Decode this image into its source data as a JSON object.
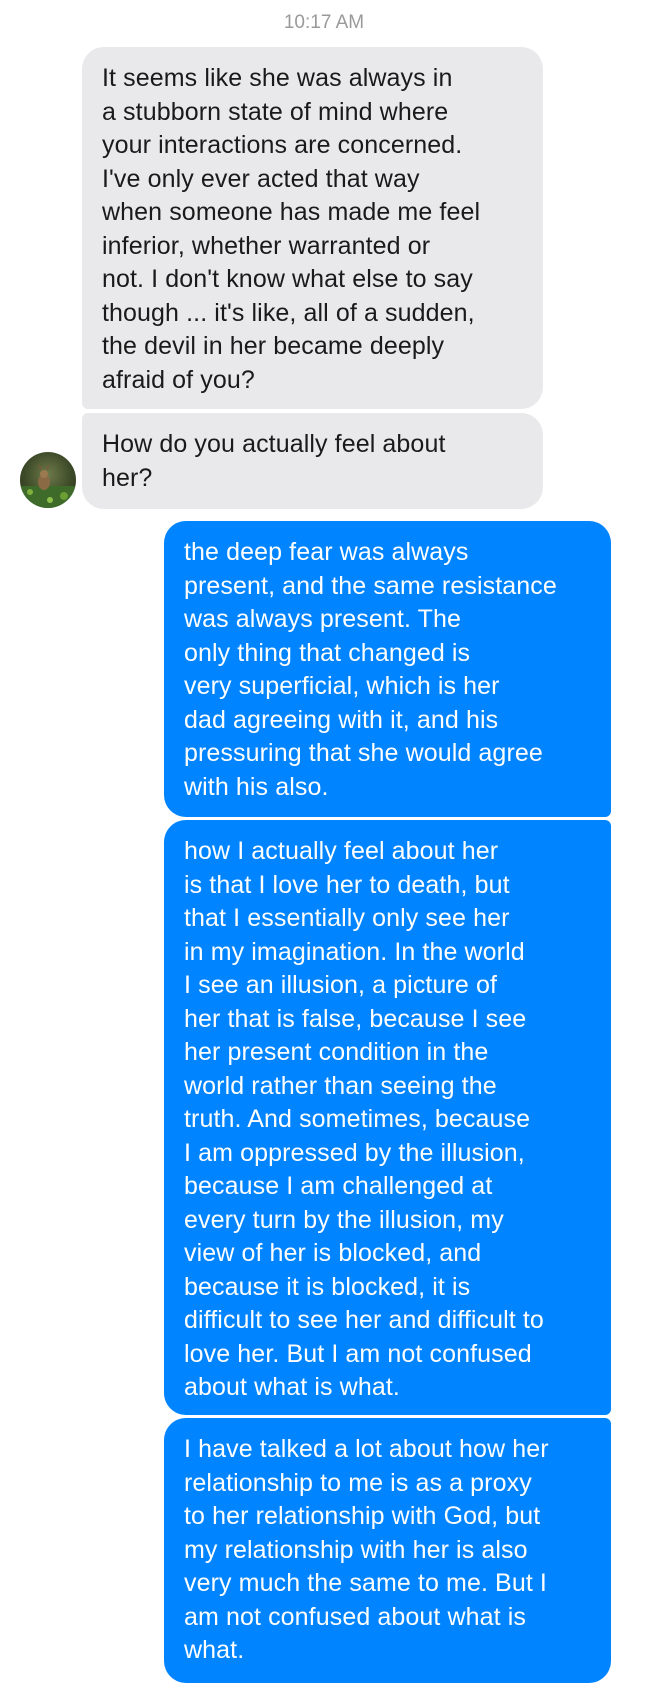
{
  "header": {
    "timestamp": "10:17 AM"
  },
  "contact": {
    "avatar_icon": "nature-photo-avatar"
  },
  "messages": [
    {
      "sender": "incoming",
      "text": "It seems like she was always in\na stubborn state of mind where\nyour interactions are concerned.\nI've only ever acted that way\nwhen someone has made me feel\ninferior, whether warranted or\nnot. I don't know what else to say\nthough ... it's like, all of a sudden,\nthe devil in her became deeply\nafraid of you?"
    },
    {
      "sender": "incoming",
      "text": "How do you actually feel about\nher?"
    },
    {
      "sender": "outgoing",
      "text": "the deep fear was always\npresent, and the same resistance\nwas always present. The\nonly thing that changed is\nvery superficial, which is her\ndad agreeing with it, and his\npressuring that she would agree\nwith his also."
    },
    {
      "sender": "outgoing",
      "text": "how I actually feel about her\nis that I love her to death, but\nthat I essentially only see her\nin my imagination. In the world\nI see an illusion, a picture of\nher that is false, because I see\nher present condition in the\nworld rather than seeing the\ntruth. And sometimes, because\nI am oppressed by the illusion,\nbecause I am challenged at\nevery turn by the illusion, my\nview of her is blocked, and\nbecause it is blocked, it is\ndifficult to see her and difficult to\nlove her. But I am not confused\nabout what is what."
    },
    {
      "sender": "outgoing",
      "text": "I have talked a lot about how her\nrelationship to me is as a proxy\nto her relationship with God, but\nmy relationship with her is also\nvery much the same to me. But I\nam not confused about what is\nwhat."
    }
  ],
  "colors": {
    "incoming_bubble": "#e9e9eb",
    "outgoing_bubble": "#0084ff",
    "timestamp_text": "#9a9a9a"
  }
}
